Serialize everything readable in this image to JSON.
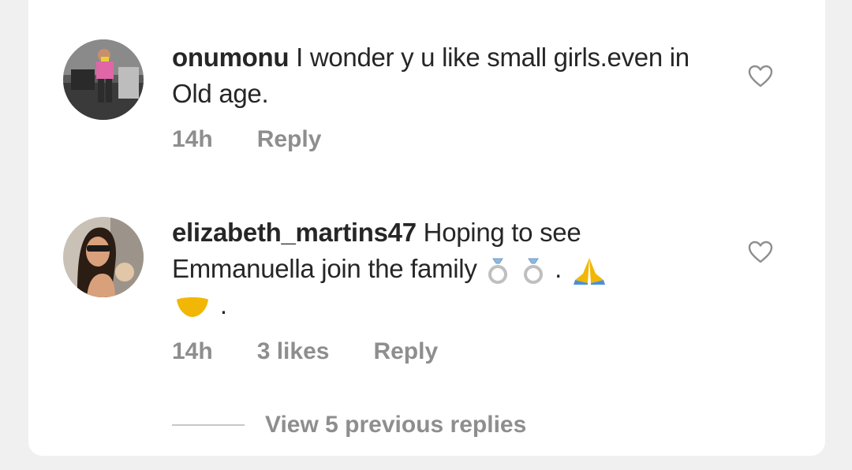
{
  "comments": [
    {
      "username": "onumonu",
      "text": "I wonder y u like small girls.even in Old age.",
      "time": "14h",
      "reply_label": "Reply",
      "avatar_icon": "user-avatar-icon"
    },
    {
      "username": "elizabeth_martins47",
      "text_before": "Hoping to see Emmanuella join the family",
      "text_end": ".",
      "time": "14h",
      "likes": "3 likes",
      "reply_label": "Reply",
      "emojis": [
        "ring-emoji",
        "ring-emoji",
        "folded-hands-emoji",
        "handshake-emoji"
      ],
      "avatar_icon": "user-avatar-icon"
    }
  ],
  "view_replies_label": "View 5 previous replies",
  "colors": {
    "text": "#262626",
    "secondary": "#8e8e8e",
    "emoji_yellow": "#f2b705",
    "ring_blue": "#8fb8de"
  }
}
